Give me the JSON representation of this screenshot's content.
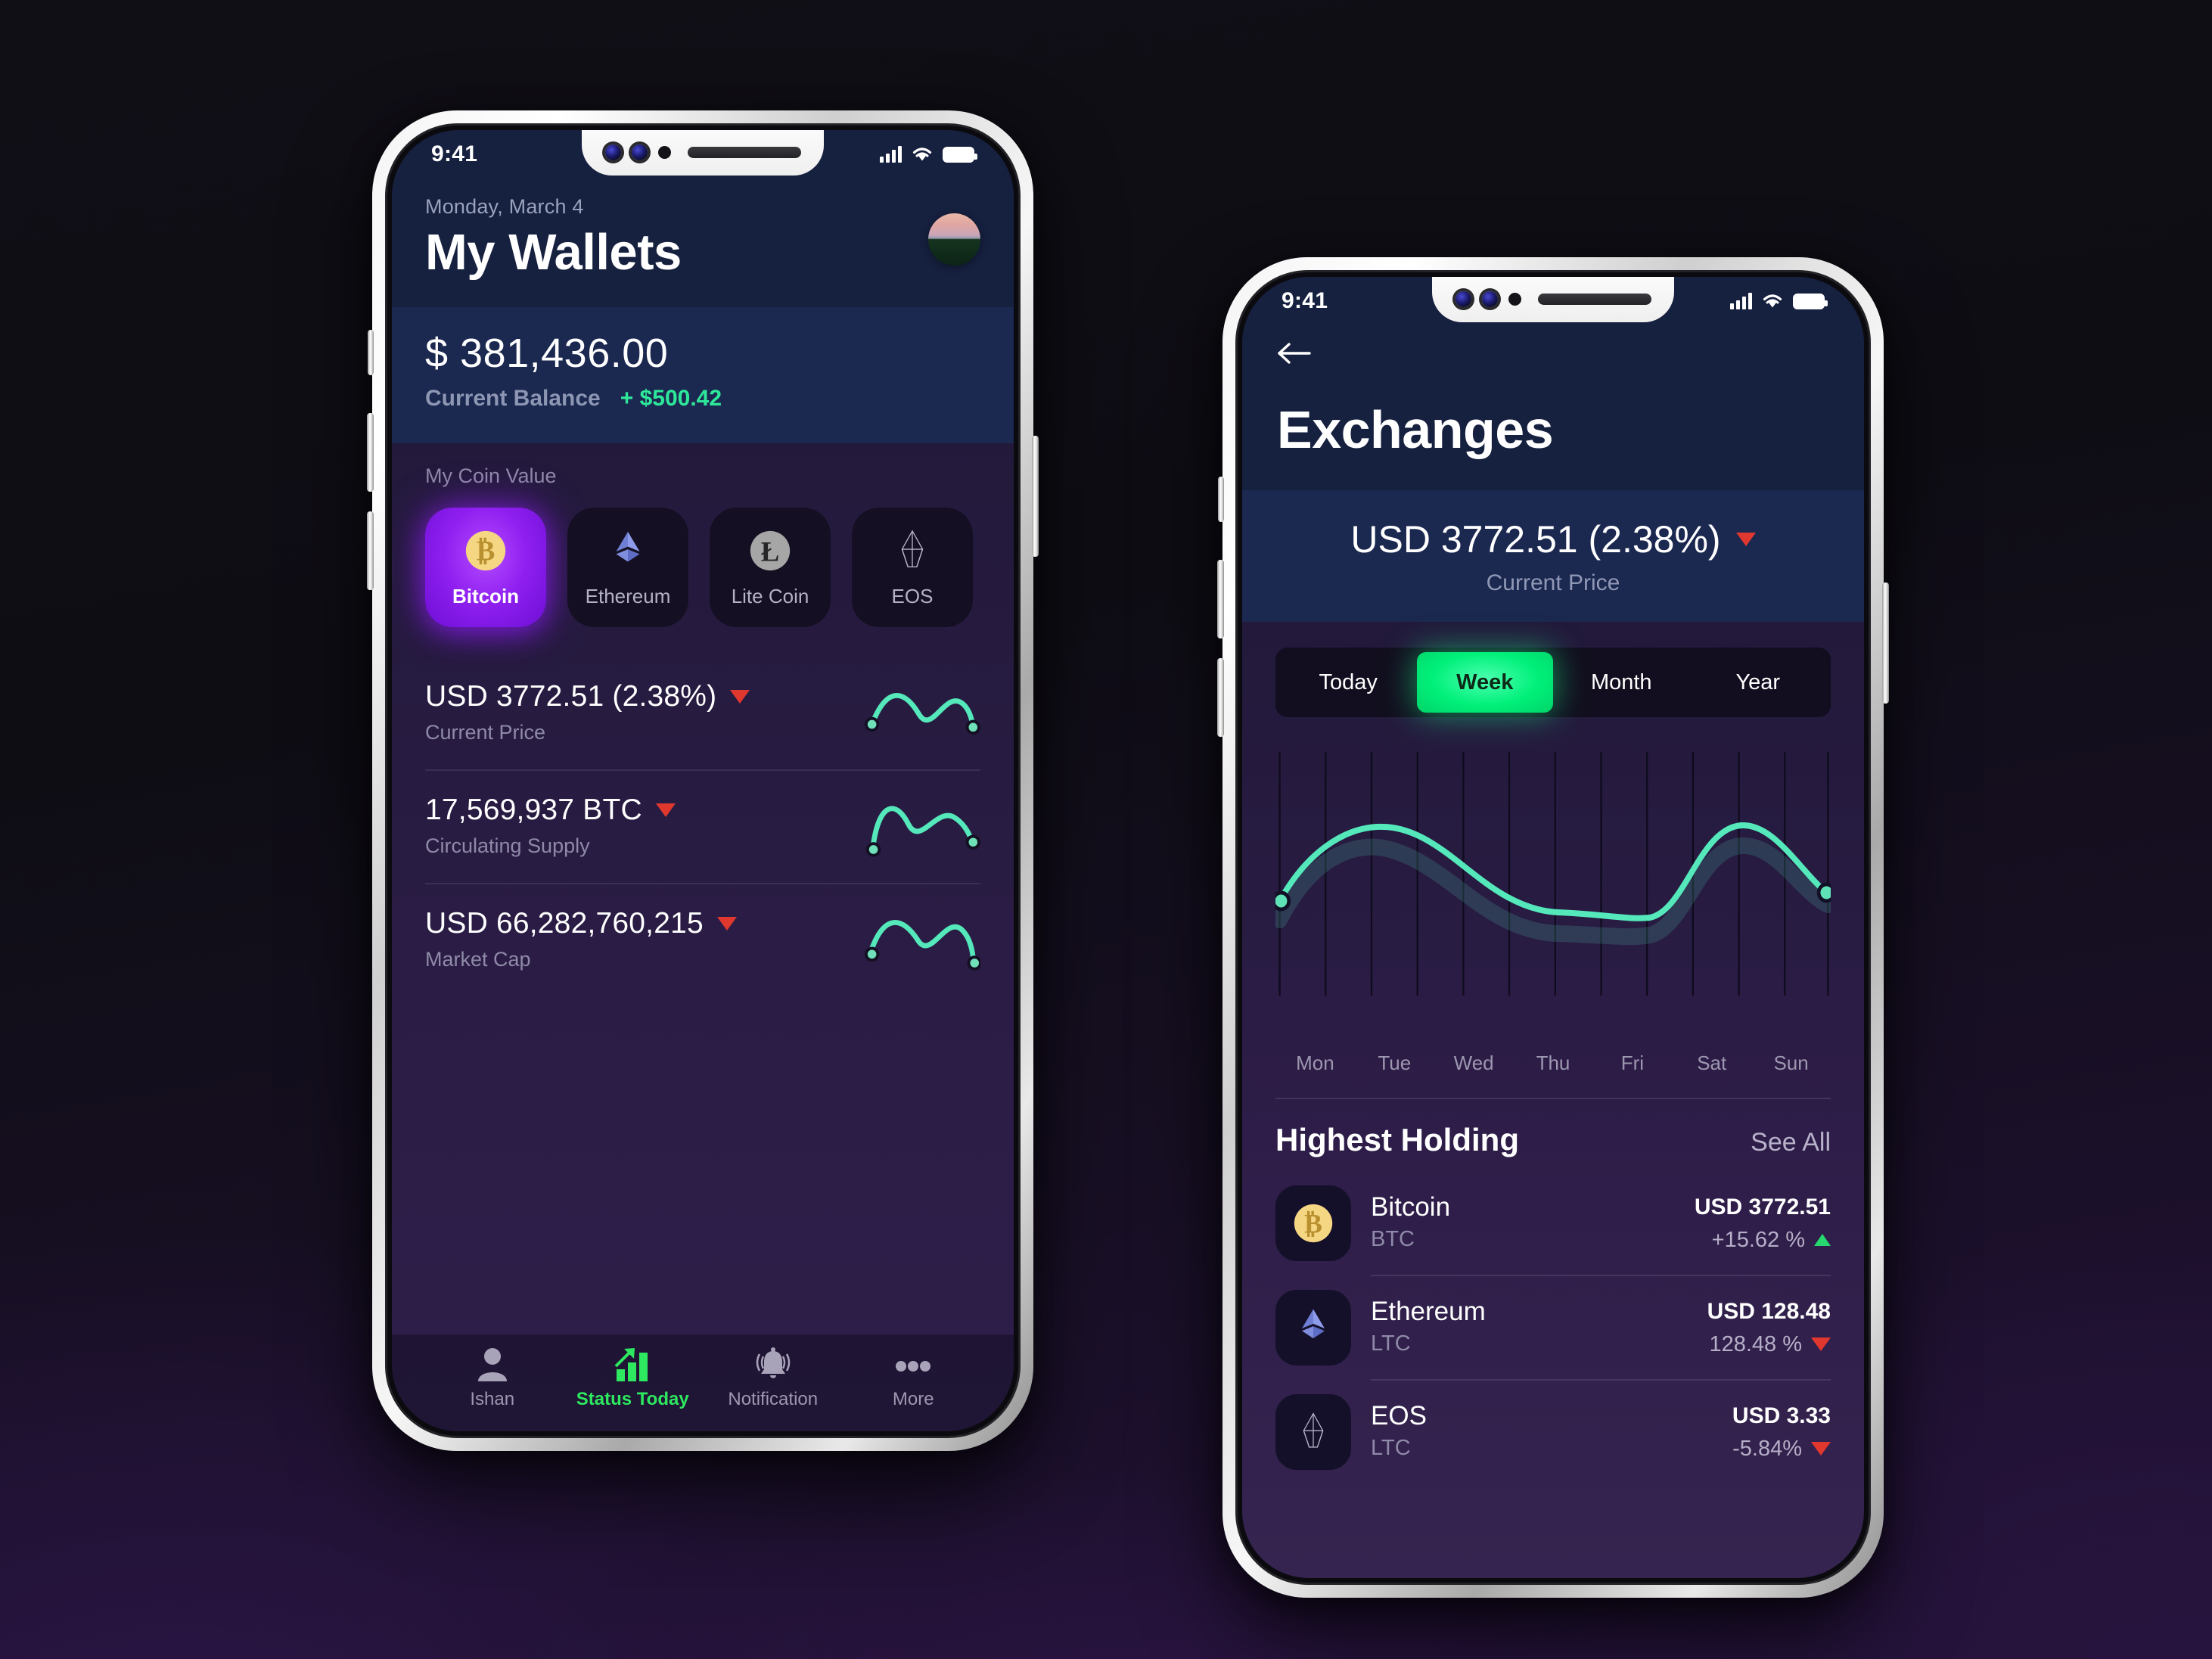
{
  "wallets": {
    "status_bar": {
      "time": "9:41",
      "signal_icon": "signal-bars-icon",
      "wifi_icon": "wifi-icon",
      "battery_icon": "battery-icon"
    },
    "header": {
      "date": "Monday, March 4",
      "title": "My Wallets",
      "avatar": "user-avatar"
    },
    "balance": {
      "amount": "$ 381,436.00",
      "label": "Current Balance",
      "delta": "+ $500.42",
      "delta_color": "#2ee89a"
    },
    "coin_section_label": "My Coin Value",
    "coins": [
      {
        "name": "Bitcoin",
        "icon": "bitcoin-icon",
        "active": true
      },
      {
        "name": "Ethereum",
        "icon": "ethereum-icon",
        "active": false
      },
      {
        "name": "Lite Coin",
        "icon": "litecoin-icon",
        "active": false
      },
      {
        "name": "EOS",
        "icon": "eos-icon",
        "active": false
      }
    ],
    "stats": [
      {
        "value": "USD 3772.51 (2.38%)",
        "label": "Current Price",
        "trend": "down"
      },
      {
        "value": "17,569,937 BTC",
        "label": "Circulating Supply",
        "trend": "down"
      },
      {
        "value": "USD 66,282,760,215",
        "label": "Market Cap",
        "trend": "down"
      }
    ],
    "tabs": [
      {
        "label": "Ishan",
        "icon": "person-icon",
        "active": false
      },
      {
        "label": "Status Today",
        "icon": "bar-chart-arrow-icon",
        "active": true
      },
      {
        "label": "Notification",
        "icon": "bell-icon",
        "active": false
      },
      {
        "label": "More",
        "icon": "ellipsis-icon",
        "active": false
      }
    ]
  },
  "exchanges": {
    "status_bar": {
      "time": "9:41",
      "signal_icon": "signal-bars-icon",
      "wifi_icon": "wifi-icon",
      "battery_icon": "battery-icon"
    },
    "header": {
      "back_icon": "back-arrow-icon",
      "title": "Exchanges"
    },
    "price": {
      "value": "USD 3772.51 (2.38%)",
      "label": "Current Price",
      "trend": "down"
    },
    "range_tabs": [
      {
        "label": "Today",
        "active": false
      },
      {
        "label": "Week",
        "active": true
      },
      {
        "label": "Month",
        "active": false
      },
      {
        "label": "Year",
        "active": false
      }
    ],
    "holdings_header": {
      "title": "Highest Holding",
      "see_all": "See All"
    },
    "holdings": [
      {
        "name": "Bitcoin",
        "symbol": "BTC",
        "icon": "bitcoin-icon",
        "price": "USD 3772.51",
        "change": "+15.62 %",
        "trend": "up"
      },
      {
        "name": "Ethereum",
        "symbol": "LTC",
        "icon": "ethereum-icon",
        "price": "USD 128.48",
        "change": "128.48 %",
        "trend": "down"
      },
      {
        "name": "EOS",
        "symbol": "LTC",
        "icon": "eos-icon",
        "price": "USD 3.33",
        "change": "-5.84%",
        "trend": "down"
      }
    ]
  },
  "chart_data": {
    "type": "line",
    "title": "",
    "xlabel": "",
    "ylabel": "",
    "categories": [
      "Mon",
      "Tue",
      "Wed",
      "Thu",
      "Fri",
      "Sat",
      "Sun"
    ],
    "x": [
      0,
      1,
      2,
      3,
      4,
      5,
      6
    ],
    "values": [
      18,
      76,
      62,
      34,
      14,
      82,
      30
    ],
    "ylim": [
      0,
      100
    ],
    "grid": true,
    "gridlines_vertical": 13,
    "legend": "none",
    "series_color": "#54e8bb",
    "endpoint_markers": [
      "Mon",
      "Sun"
    ]
  },
  "colors": {
    "accent_green": "#2ee85f",
    "accent_teal": "#54e8bb",
    "accent_purple": "#8f1ff0",
    "down_red": "#e0382f",
    "up_green": "#26d86e",
    "navy_header": "#16203f",
    "navy_band": "#1b2850"
  }
}
